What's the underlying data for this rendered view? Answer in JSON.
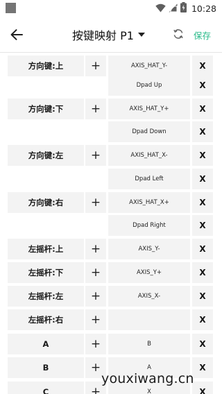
{
  "status_bar": {
    "time": "10:28"
  },
  "header": {
    "title": "按键映射 P1",
    "save_label": "保存"
  },
  "rows": [
    {
      "key": "方向键:上",
      "add": "+",
      "value": "AXIS_HAT_Y-",
      "delete": "X"
    },
    {
      "key": "",
      "add": "",
      "value": "Dpad Up",
      "delete": "X"
    },
    {
      "key": "方向键:下",
      "add": "+",
      "value": "AXIS_HAT_Y+",
      "delete": "X"
    },
    {
      "key": "",
      "add": "",
      "value": "Dpad Down",
      "delete": "X"
    },
    {
      "key": "方向键:左",
      "add": "+",
      "value": "AXIS_HAT_X-",
      "delete": "X"
    },
    {
      "key": "",
      "add": "",
      "value": "Dpad Left",
      "delete": "X"
    },
    {
      "key": "方向键:右",
      "add": "+",
      "value": "AXIS_HAT_X+",
      "delete": "X"
    },
    {
      "key": "",
      "add": "",
      "value": "Dpad Right",
      "delete": "X"
    },
    {
      "key": "左摇杆:上",
      "add": "+",
      "value": "AXIS_Y-",
      "delete": "X"
    },
    {
      "key": "左摇杆:下",
      "add": "+",
      "value": "AXIS_Y+",
      "delete": "X"
    },
    {
      "key": "左摇杆:左",
      "add": "+",
      "value": "AXIS_X-",
      "delete": "X"
    },
    {
      "key": "左摇杆:右",
      "add": "+",
      "value": "",
      "delete": "X"
    },
    {
      "key": "A",
      "add": "+",
      "value": "B",
      "delete": "X"
    },
    {
      "key": "B",
      "add": "+",
      "value": "A",
      "delete": "X"
    },
    {
      "key": "C",
      "add": "+",
      "value": "X",
      "delete": "X"
    }
  ],
  "watermark": "youxiwang.cn"
}
